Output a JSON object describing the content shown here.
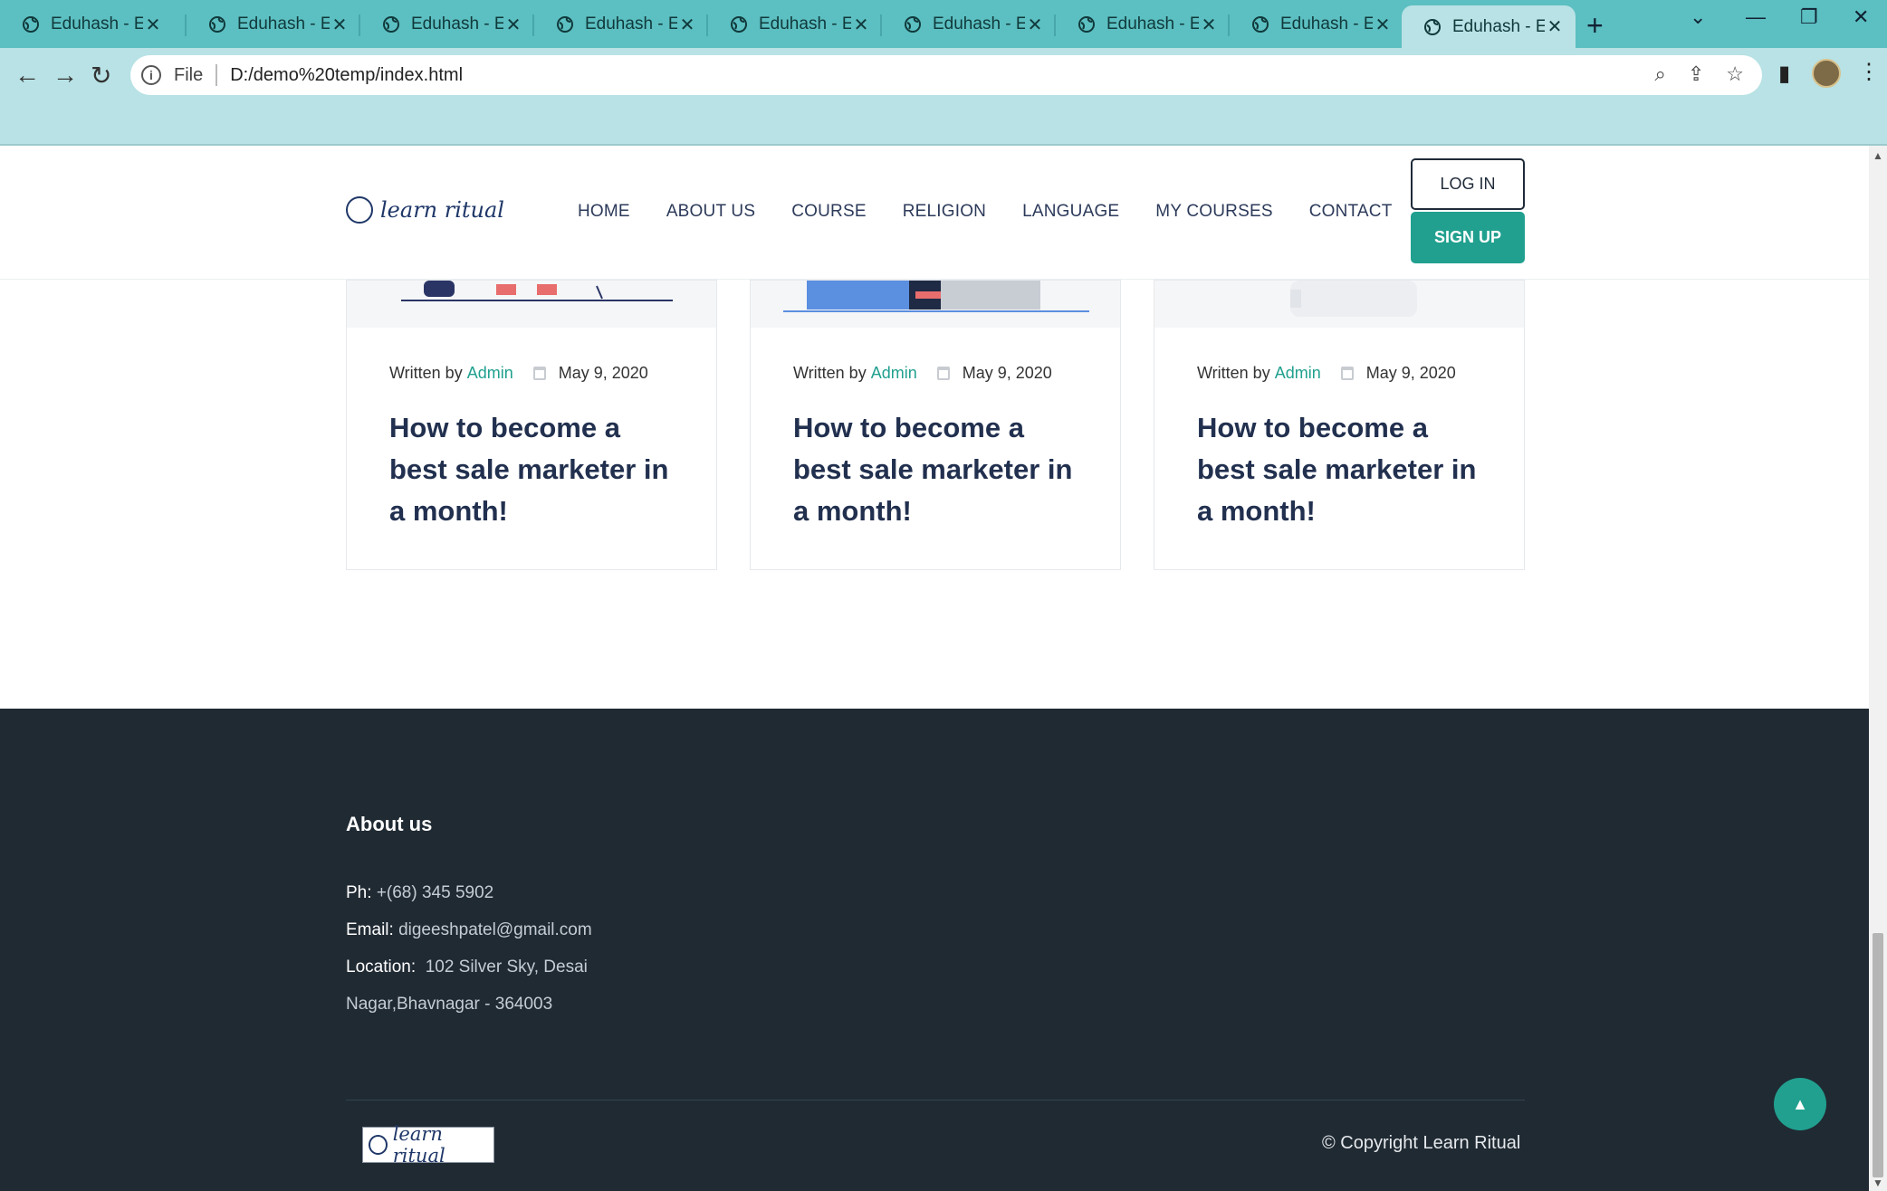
{
  "browser": {
    "tabs": [
      {
        "title": "Eduhash - Educ"
      },
      {
        "title": "Eduhash - Educ"
      },
      {
        "title": "Eduhash - Educ"
      },
      {
        "title": "Eduhash - Educ"
      },
      {
        "title": "Eduhash - Educ"
      },
      {
        "title": "Eduhash - Educ"
      },
      {
        "title": "Eduhash - Educ"
      },
      {
        "title": "Eduhash - Educ"
      },
      {
        "title": "Eduhash - Educ"
      }
    ],
    "active_tab": 8,
    "address": {
      "scheme": "File",
      "url": "D:/demo%20temp/index.html"
    }
  },
  "header": {
    "logo_text": "learn ritual",
    "nav": [
      "HOME",
      "ABOUT US",
      "COURSE",
      "RELIGION",
      "LANGUAGE",
      "MY COURSES",
      "CONTACT"
    ],
    "login_label": "LOG IN",
    "signup_label": "SIGN UP"
  },
  "cards": [
    {
      "written_by": "Written by",
      "author": "Admin",
      "date": "May 9, 2020",
      "title": "How to become a best sale marketer in a month!"
    },
    {
      "written_by": "Written by",
      "author": "Admin",
      "date": "May 9, 2020",
      "title": "How to become a best sale marketer in a month!"
    },
    {
      "written_by": "Written by",
      "author": "Admin",
      "date": "May 9, 2020",
      "title": "How to become a best sale marketer in a month!"
    }
  ],
  "footer": {
    "heading": "About us",
    "phone_label": "Ph:",
    "phone": "+(68) 345 5902",
    "email_label": "Email:",
    "email": "digeeshpatel@gmail.com",
    "location_label": "Location:",
    "location_line1": "102 Silver Sky, Desai",
    "location_line2": "Nagar,Bhavnagar - 364003",
    "logo_text": "learn ritual",
    "copyright": "© Copyright Learn Ritual"
  },
  "colors": {
    "accent": "#21a08f",
    "footer_bg": "#202a33",
    "tabbar": "#5cbfc1",
    "toolbar": "#b8e2e5"
  },
  "icons": {
    "back": "arrow-left-icon",
    "forward": "arrow-right-icon",
    "reload": "reload-icon",
    "to_top": "chevron-up-icon"
  }
}
